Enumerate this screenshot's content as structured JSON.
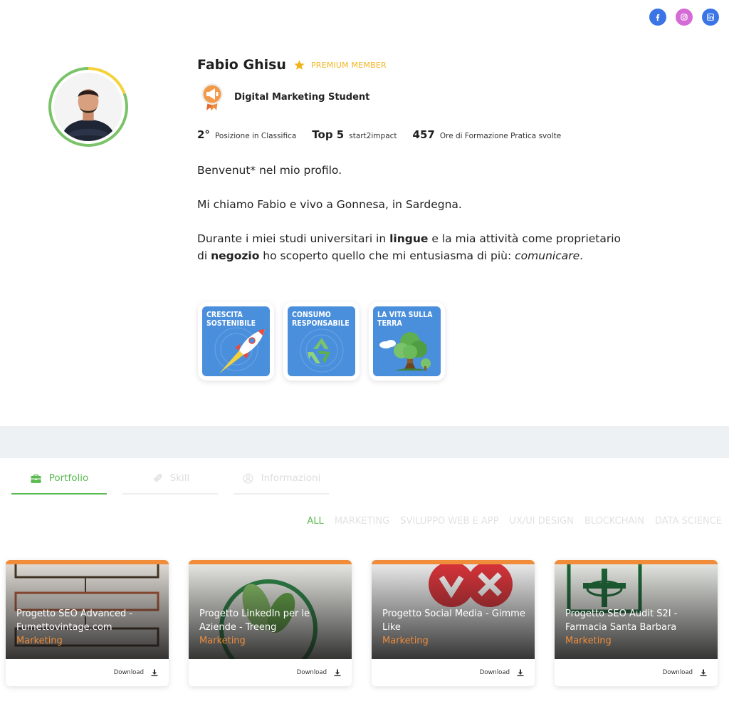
{
  "social": {
    "facebook": {
      "icon": "facebook-icon",
      "color": "#3b74e6"
    },
    "instagram": {
      "icon": "instagram-icon",
      "color": "#d46bd6"
    },
    "linkedin": {
      "icon": "linkedin-icon",
      "color": "#3b74e6"
    }
  },
  "profile": {
    "name": "Fabio Ghisu",
    "premium": "PREMIUM MEMBER",
    "role": "Digital Marketing Student",
    "stats": [
      {
        "value": "2°",
        "label": "Posizione in Classifica"
      },
      {
        "value": "Top 5",
        "label": "start2impact"
      },
      {
        "value": "457",
        "label": "Ore di Formazione Pratica svolte"
      }
    ],
    "bio": {
      "p1": "Benvenut* nel mio profilo.",
      "p2": "Mi chiamo Fabio e vivo a Gonnesa, in Sardegna.",
      "p3a": "Durante i miei studi universitari in ",
      "p3b": "lingue",
      "p3c": " e la mia attività come proprietario di ",
      "p3d": "negozio",
      "p3e": " ho scoperto quello che mi entusiasma di più: ",
      "p3f": "comunicare",
      "p3g": "."
    },
    "badges": [
      {
        "title": "CRESCITA SOSTENIBILE",
        "icon": "rocket-icon"
      },
      {
        "title": "CONSUMO RESPONSABILE",
        "icon": "recycle-icon"
      },
      {
        "title": "LA VITA SULLA TERRA",
        "icon": "tree-icon"
      }
    ]
  },
  "tabs": [
    {
      "label": "Portfolio",
      "icon": "briefcase-icon",
      "active": true
    },
    {
      "label": "Skill",
      "icon": "rocket-icon",
      "active": false
    },
    {
      "label": "Informazioni",
      "icon": "user-icon",
      "active": false
    }
  ],
  "filters": [
    "ALL",
    "MARKETING",
    "SVILUPPO WEB E APP",
    "UX/UI DESIGN",
    "BLOCKCHAIN",
    "DATA SCIENCE"
  ],
  "projects": [
    {
      "title": "Progetto SEO Advanced - Fumettovintage.com",
      "category": "Marketing",
      "download": "Download"
    },
    {
      "title": "Progetto LinkedIn per le Aziende - Treeng",
      "category": "Marketing",
      "download": "Download"
    },
    {
      "title": "Progetto Social Media - Gimme Like",
      "category": "Marketing",
      "download": "Download"
    },
    {
      "title": "Progetto SEO Audit S2I - Farmacia Santa Barbara",
      "category": "Marketing",
      "download": "Download"
    }
  ],
  "colors": {
    "accent_green": "#5aba4f",
    "accent_orange": "#f08c3a",
    "premium_gold": "#f2b41d",
    "badge_blue": "#4a8fdc"
  }
}
